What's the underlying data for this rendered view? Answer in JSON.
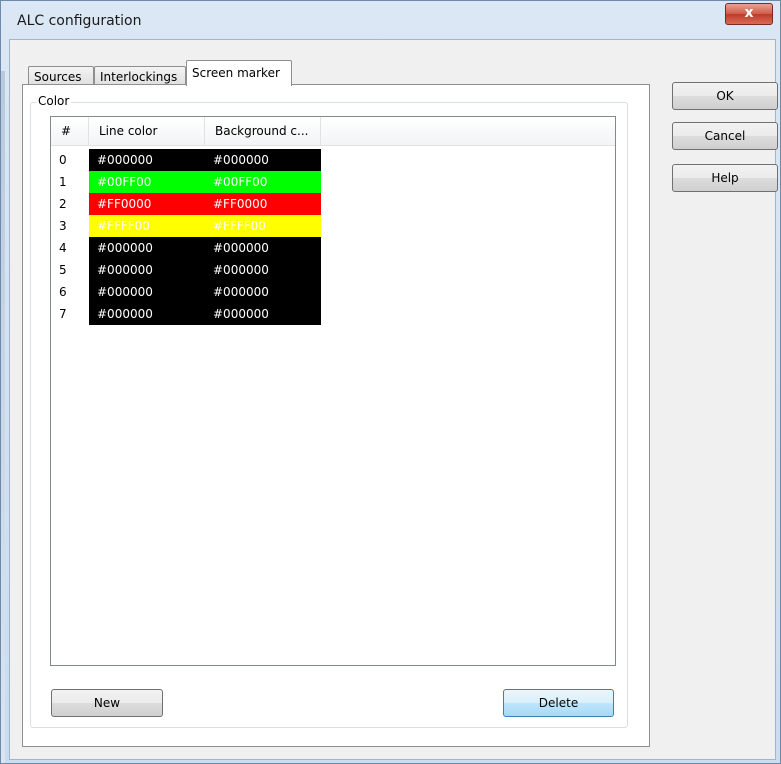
{
  "window": {
    "title": "ALC configuration",
    "close_label": "x"
  },
  "tabs": [
    {
      "label": "Sources",
      "active": false
    },
    {
      "label": "Interlockings",
      "active": false
    },
    {
      "label": "Screen marker",
      "active": true
    }
  ],
  "group": {
    "label": "Color"
  },
  "list": {
    "columns": [
      "#",
      "Line color",
      "Background c..."
    ],
    "rows": [
      {
        "index": "0",
        "line_color": "#000000",
        "bg_color": "#000000",
        "fill": "#000000",
        "text_color": "#ffffff"
      },
      {
        "index": "1",
        "line_color": "#00FF00",
        "bg_color": "#00FF00",
        "fill": "#00ff00",
        "text_color": "#ffffff"
      },
      {
        "index": "2",
        "line_color": "#FF0000",
        "bg_color": "#FF0000",
        "fill": "#ff0000",
        "text_color": "#ffffff"
      },
      {
        "index": "3",
        "line_color": "#FFFF00",
        "bg_color": "#FFFF00",
        "fill": "#ffff00",
        "text_color": "#ffffff"
      },
      {
        "index": "4",
        "line_color": "#000000",
        "bg_color": "#000000",
        "fill": "#000000",
        "text_color": "#ffffff"
      },
      {
        "index": "5",
        "line_color": "#000000",
        "bg_color": "#000000",
        "fill": "#000000",
        "text_color": "#ffffff"
      },
      {
        "index": "6",
        "line_color": "#000000",
        "bg_color": "#000000",
        "fill": "#000000",
        "text_color": "#ffffff"
      },
      {
        "index": "7",
        "line_color": "#000000",
        "bg_color": "#000000",
        "fill": "#000000",
        "text_color": "#ffffff"
      }
    ]
  },
  "buttons": {
    "new": "New",
    "delete": "Delete",
    "ok": "OK",
    "cancel": "Cancel",
    "help": "Help"
  }
}
